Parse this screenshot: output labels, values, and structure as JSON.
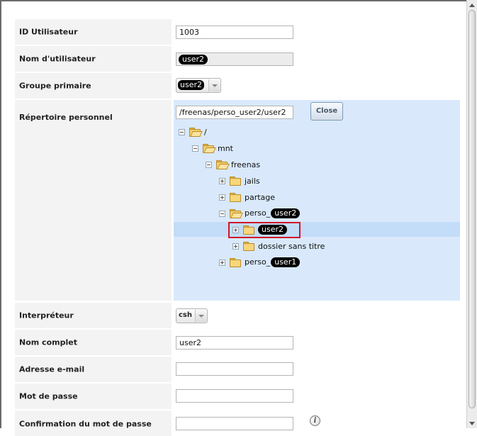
{
  "form": {
    "fields": [
      {
        "label": "ID Utilisateur",
        "value": "1003"
      },
      {
        "label": "Nom d'utilisateur",
        "value": "user2"
      },
      {
        "label": "Groupe primaire",
        "value": "user2"
      },
      {
        "label": "Répertoire personnel",
        "value": "/freenas/perso_user2/user2"
      },
      {
        "label": "Interpréteur",
        "value": "csh"
      },
      {
        "label": "Nom complet",
        "value": "user2"
      },
      {
        "label": "Adresse e-mail",
        "value": ""
      },
      {
        "label": "Mot de passe",
        "value": ""
      },
      {
        "label": "Confirmation du mot de passe",
        "value": ""
      }
    ],
    "close_label": "Close"
  },
  "tree": {
    "root": "/",
    "mnt": "mnt",
    "freenas": "freenas",
    "jails": "jails",
    "partage": "partage",
    "perso_prefix": "perso_",
    "perso_user2_redacted": "user2",
    "user2_folder": "user2",
    "dossier": "dossier sans titre",
    "perso_user1_redacted": "user1"
  },
  "colors": {
    "tree_bg": "#d9e9fb",
    "selected_row": "#c3dcf7",
    "highlight_border": "#d0162a",
    "label_bg": "#f3f3f3"
  },
  "icons": [
    "folder-icon",
    "folder-open-icon",
    "expand-icon",
    "collapse-icon",
    "info-icon"
  ]
}
